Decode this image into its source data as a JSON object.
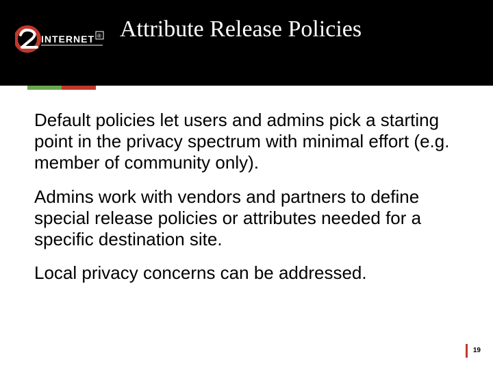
{
  "header": {
    "title": "Attribute Release Policies",
    "logo": {
      "brand_left": "INTERNET",
      "brand_right": "®"
    }
  },
  "body": {
    "paragraphs": [
      "Default policies let users and admins pick a starting point in the privacy spectrum with minimal effort (e.g. member of community only).",
      "Admins work with vendors and partners to define special release policies or attributes needed for a specific destination site.",
      "Local privacy concerns can be addressed."
    ]
  },
  "footer": {
    "page_number": "19"
  },
  "colors": {
    "accent_green": "#6aa84f",
    "accent_red": "#c0392b",
    "header_bg": "#000000"
  }
}
